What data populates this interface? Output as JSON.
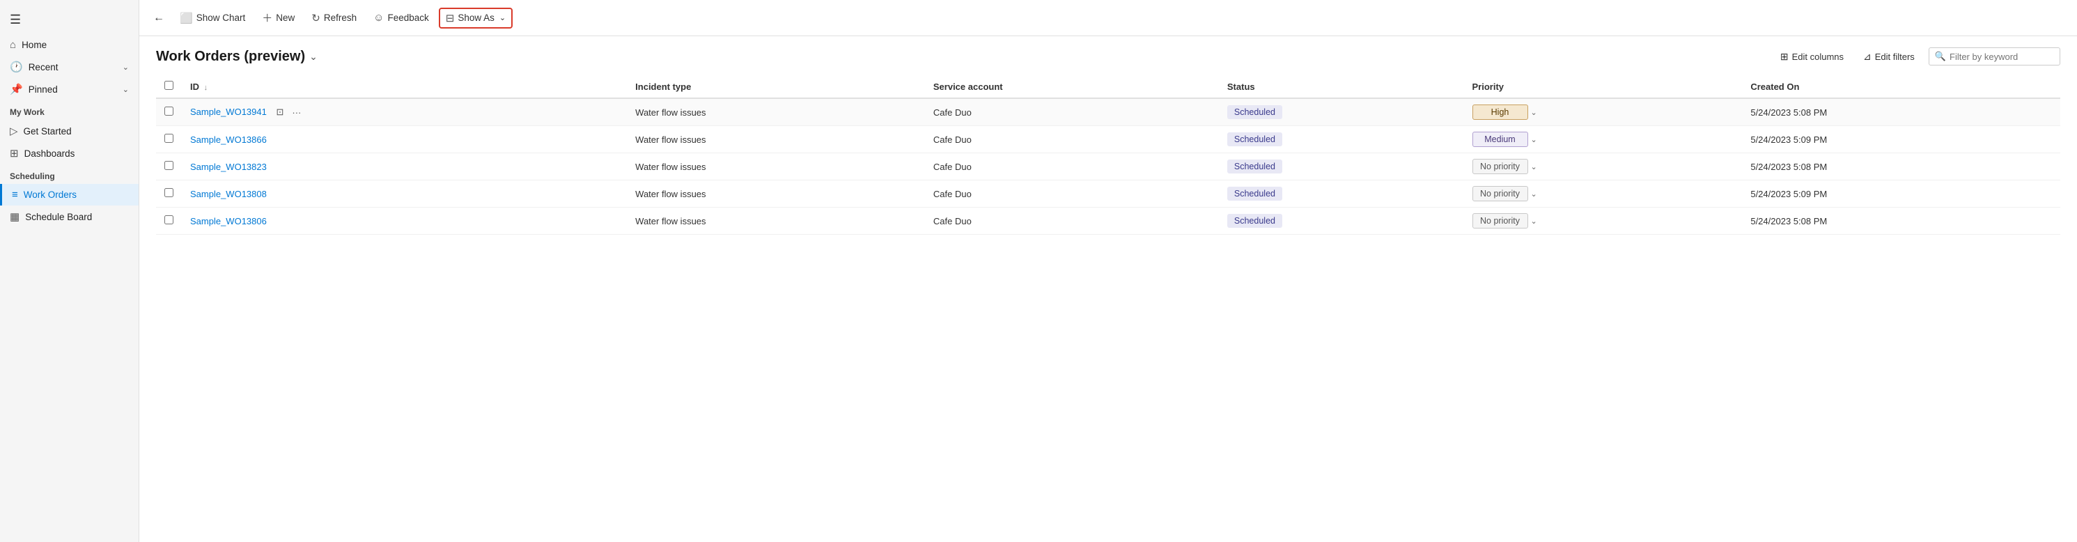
{
  "sidebar": {
    "hamburger_icon": "☰",
    "items": [
      {
        "id": "home",
        "label": "Home",
        "icon": "⌂",
        "has_chevron": false
      },
      {
        "id": "recent",
        "label": "Recent",
        "icon": "🕐",
        "has_chevron": true
      },
      {
        "id": "pinned",
        "label": "Pinned",
        "icon": "📌",
        "has_chevron": true
      }
    ],
    "my_work_label": "My Work",
    "my_work_items": [
      {
        "id": "get-started",
        "label": "Get Started",
        "icon": "▷"
      },
      {
        "id": "dashboards",
        "label": "Dashboards",
        "icon": "⊞"
      }
    ],
    "scheduling_label": "Scheduling",
    "scheduling_items": [
      {
        "id": "work-orders",
        "label": "Work Orders",
        "icon": "≡",
        "active": true
      },
      {
        "id": "schedule-board",
        "label": "Schedule Board",
        "icon": "▦"
      }
    ]
  },
  "toolbar": {
    "back_icon": "←",
    "show_chart_label": "Show Chart",
    "new_label": "New",
    "refresh_label": "Refresh",
    "feedback_label": "Feedback",
    "show_as_label": "Show As"
  },
  "page": {
    "title": "Work Orders (preview)",
    "edit_columns_label": "Edit columns",
    "edit_filters_label": "Edit filters",
    "filter_placeholder": "Filter by keyword"
  },
  "table": {
    "columns": [
      {
        "id": "id",
        "label": "ID",
        "sortable": true
      },
      {
        "id": "incident_type",
        "label": "Incident type",
        "sortable": false
      },
      {
        "id": "service_account",
        "label": "Service account",
        "sortable": false
      },
      {
        "id": "status",
        "label": "Status",
        "sortable": false
      },
      {
        "id": "priority",
        "label": "Priority",
        "sortable": false
      },
      {
        "id": "created_on",
        "label": "Created On",
        "sortable": false
      }
    ],
    "rows": [
      {
        "id": "Sample_WO13941",
        "incident_type": "Water flow issues",
        "service_account": "Cafe Duo",
        "status": "Scheduled",
        "priority": "High",
        "priority_class": "high",
        "created_on": "5/24/2023 5:08 PM",
        "is_first": true
      },
      {
        "id": "Sample_WO13866",
        "incident_type": "Water flow issues",
        "service_account": "Cafe Duo",
        "status": "Scheduled",
        "priority": "Medium",
        "priority_class": "medium",
        "created_on": "5/24/2023 5:09 PM",
        "is_first": false
      },
      {
        "id": "Sample_WO13823",
        "incident_type": "Water flow issues",
        "service_account": "Cafe Duo",
        "status": "Scheduled",
        "priority": "No priority",
        "priority_class": "no-priority",
        "created_on": "5/24/2023 5:08 PM",
        "is_first": false
      },
      {
        "id": "Sample_WO13808",
        "incident_type": "Water flow issues",
        "service_account": "Cafe Duo",
        "status": "Scheduled",
        "priority": "No priority",
        "priority_class": "no-priority",
        "created_on": "5/24/2023 5:09 PM",
        "is_first": false
      },
      {
        "id": "Sample_WO13806",
        "incident_type": "Water flow issues",
        "service_account": "Cafe Duo",
        "status": "Scheduled",
        "priority": "No priority",
        "priority_class": "no-priority",
        "created_on": "5/24/2023 5:08 PM",
        "is_first": false
      }
    ]
  }
}
